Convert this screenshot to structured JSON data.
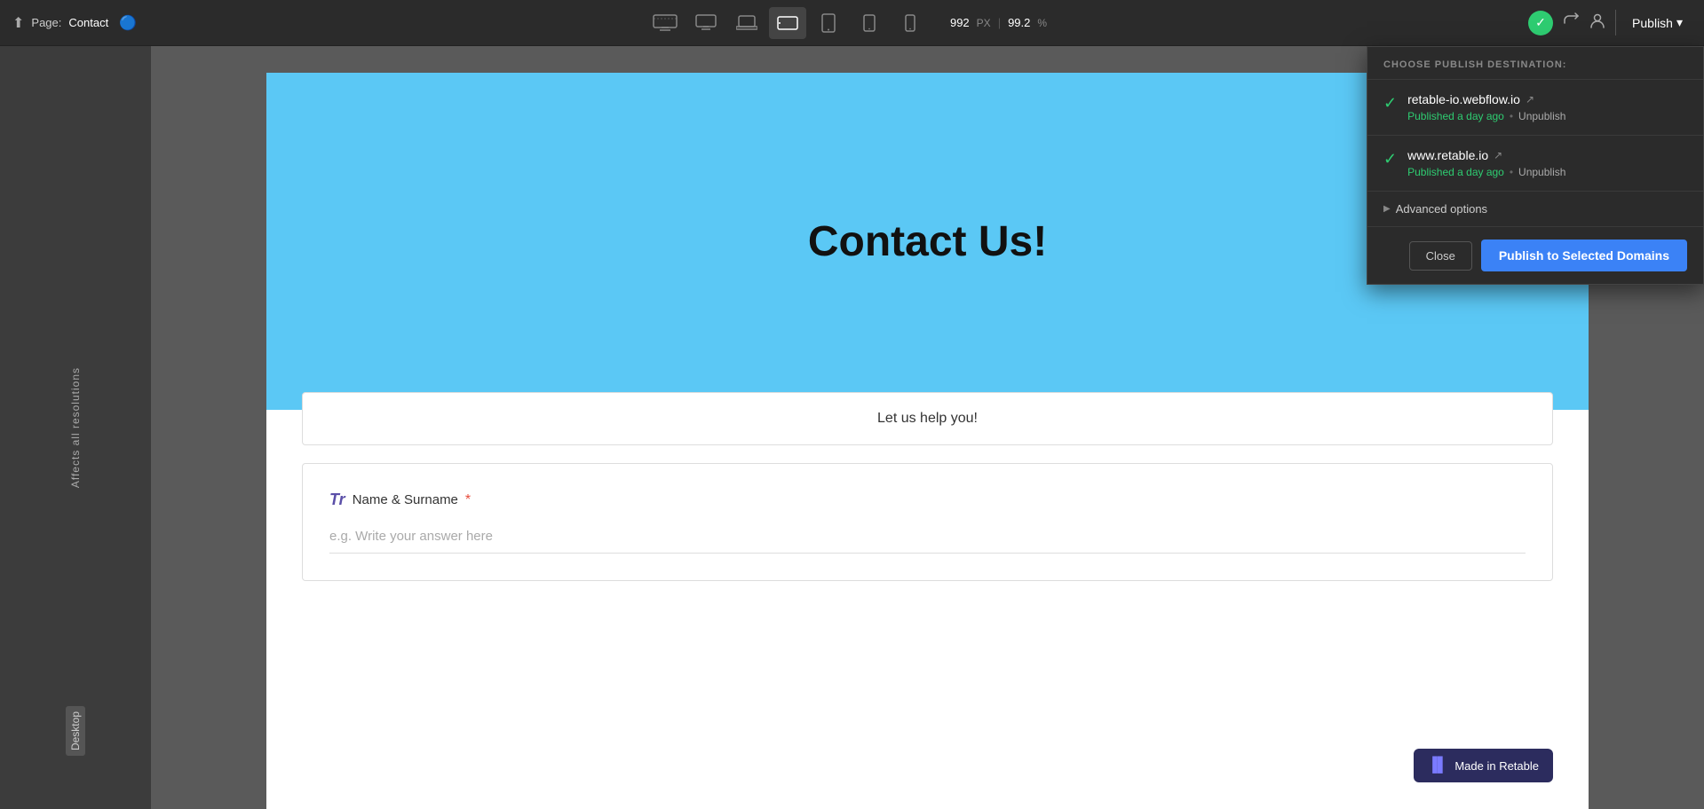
{
  "topbar": {
    "page_label": "Page:",
    "page_name": "Contact",
    "size_px": "992",
    "size_unit": "PX",
    "zoom": "99.2",
    "zoom_unit": "%",
    "publish_label": "Publish",
    "publish_arrow": "▾"
  },
  "devices": [
    {
      "id": "desktop-wide",
      "icon": "▬",
      "active": false
    },
    {
      "id": "desktop",
      "icon": "🖥",
      "active": false
    },
    {
      "id": "laptop",
      "icon": "💻",
      "active": false
    },
    {
      "id": "tablet-landscape",
      "icon": "⬛",
      "active": true
    },
    {
      "id": "tablet",
      "icon": "▭",
      "active": false
    },
    {
      "id": "tablet-small",
      "icon": "▭",
      "active": false
    },
    {
      "id": "mobile",
      "icon": "📱",
      "active": false
    }
  ],
  "sidebar": {
    "affects_label": "Affects all resolutions",
    "desktop_label": "Desktop"
  },
  "canvas": {
    "contact_title": "Contact Us!",
    "help_text": "Let us help you!",
    "field_label": "Name & Surname",
    "field_placeholder": "e.g. Write your answer here",
    "badge_text": "Made in Retable"
  },
  "publish_dropdown": {
    "header": "CHOOSE PUBLISH DESTINATION:",
    "domains": [
      {
        "name": "retable-io.webflow.io",
        "checked": true,
        "published_text": "Published a day ago",
        "unpublish_label": "Unpublish"
      },
      {
        "name": "www.retable.io",
        "checked": true,
        "published_text": "Published a day ago",
        "unpublish_label": "Unpublish"
      }
    ],
    "advanced_label": "Advanced options",
    "close_label": "Close",
    "publish_selected_label": "Publish to Selected Domains"
  }
}
